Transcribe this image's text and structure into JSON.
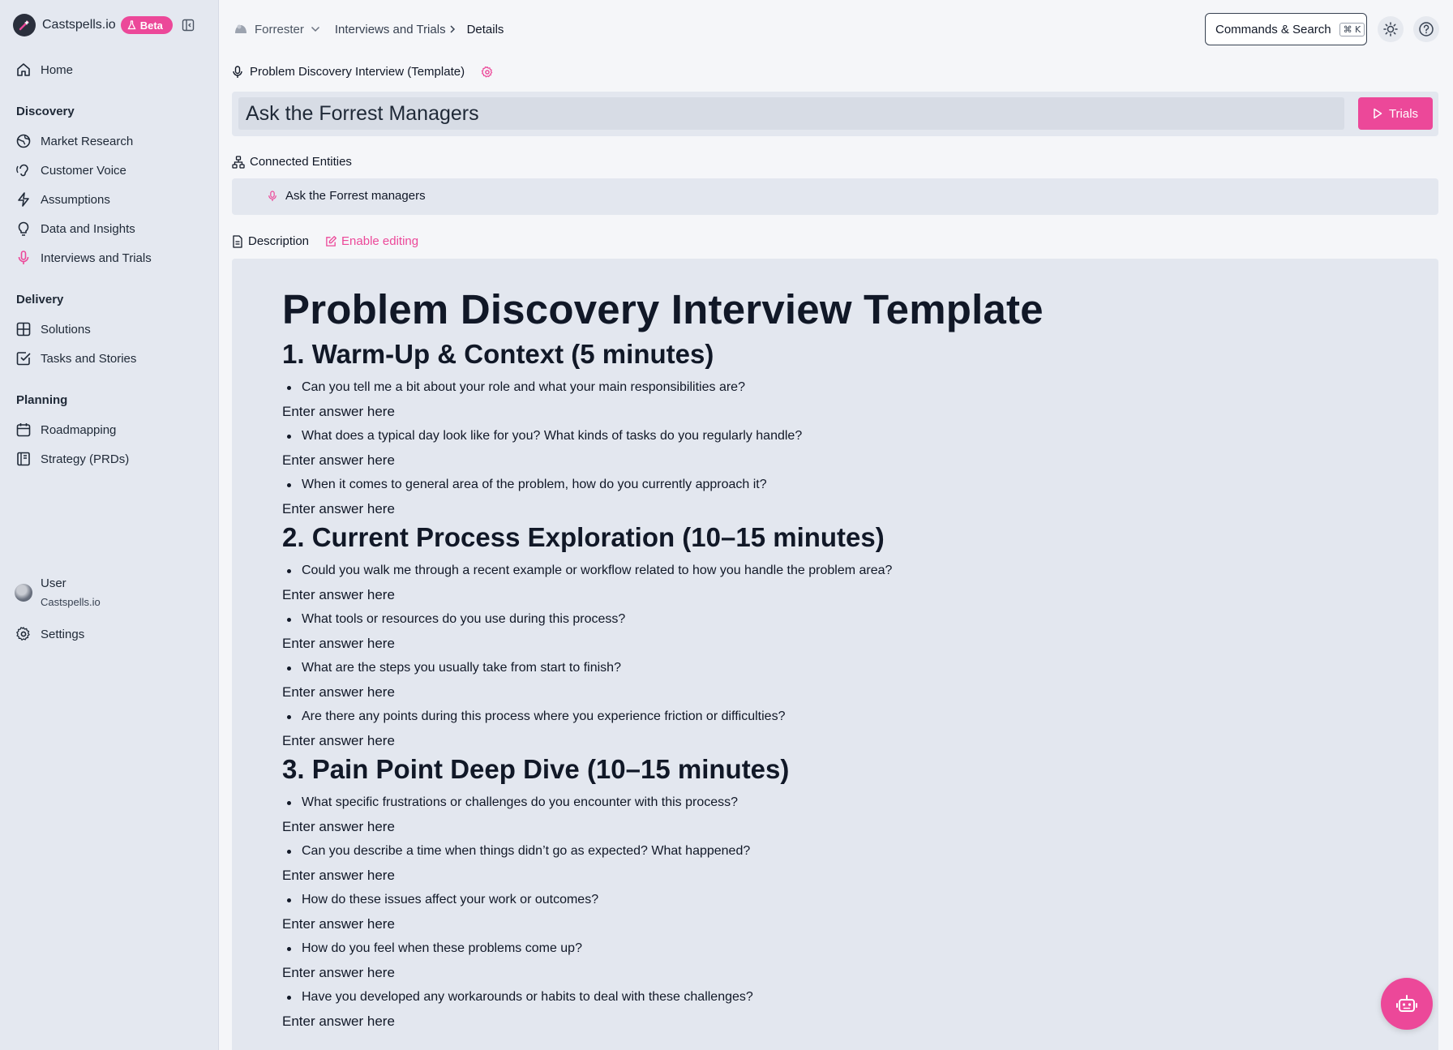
{
  "app": {
    "name": "Castspells.io",
    "badge": "Beta"
  },
  "colors": {
    "accent": "#ec4899",
    "sidebar_bg": "#e4e8f0",
    "panel_bg": "#e3e7ef"
  },
  "sidebar": {
    "home": "Home",
    "sections": [
      {
        "title": "Discovery",
        "items": [
          {
            "label": "Market Research",
            "icon": "globe-icon"
          },
          {
            "label": "Customer Voice",
            "icon": "ear-icon"
          },
          {
            "label": "Assumptions",
            "icon": "bolt-icon"
          },
          {
            "label": "Data and Insights",
            "icon": "lightbulb-icon"
          },
          {
            "label": "Interviews and Trials",
            "icon": "microphone-icon"
          }
        ]
      },
      {
        "title": "Delivery",
        "items": [
          {
            "label": "Solutions",
            "icon": "grid-icon"
          },
          {
            "label": "Tasks and Stories",
            "icon": "check-square-icon"
          }
        ]
      },
      {
        "title": "Planning",
        "items": [
          {
            "label": "Roadmapping",
            "icon": "calendar-icon"
          },
          {
            "label": "Strategy (PRDs)",
            "icon": "book-icon"
          }
        ]
      }
    ],
    "user": {
      "name": "User",
      "org": "Castspells.io"
    },
    "settings": "Settings"
  },
  "topbar": {
    "workspace": "Forrester",
    "crumb_parent": "Interviews and Trials",
    "crumb_current": "Details",
    "commands_label": "Commands & Search",
    "commands_shortcut": "⌘ K"
  },
  "document": {
    "template_name": "Problem Discovery Interview (Template)",
    "title_value": "Ask the Forrest Managers",
    "trials_button": "Trials",
    "connected_entities_label": "Connected Entities",
    "connected_entity": "Ask the Forrest managers",
    "description_label": "Description",
    "enable_editing": "Enable editing"
  },
  "content": {
    "heading": "Problem Discovery Interview Template",
    "answer_placeholder": "Enter answer here",
    "sections": [
      {
        "title": "1. Warm-Up & Context (5 minutes)",
        "questions": [
          "Can you tell me a bit about your role and what your main responsibilities are?",
          "What does a typical day look like for you? What kinds of tasks do you regularly handle?",
          "When it comes to general area of the problem, how do you currently approach it?"
        ]
      },
      {
        "title": "2. Current Process Exploration (10–15 minutes)",
        "questions": [
          "Could you walk me through a recent example or workflow related to how you handle the problem area?",
          "What tools or resources do you use during this process?",
          "What are the steps you usually take from start to finish?",
          "Are there any points during this process where you experience friction or difficulties?"
        ]
      },
      {
        "title": "3. Pain Point Deep Dive (10–15 minutes)",
        "questions": [
          "What specific frustrations or challenges do you encounter with this process?",
          "Can you describe a time when things didn’t go as expected? What happened?",
          "How do these issues affect your work or outcomes?",
          "How do you feel when these problems come up?",
          "Have you developed any workarounds or habits to deal with these challenges?"
        ]
      }
    ]
  }
}
